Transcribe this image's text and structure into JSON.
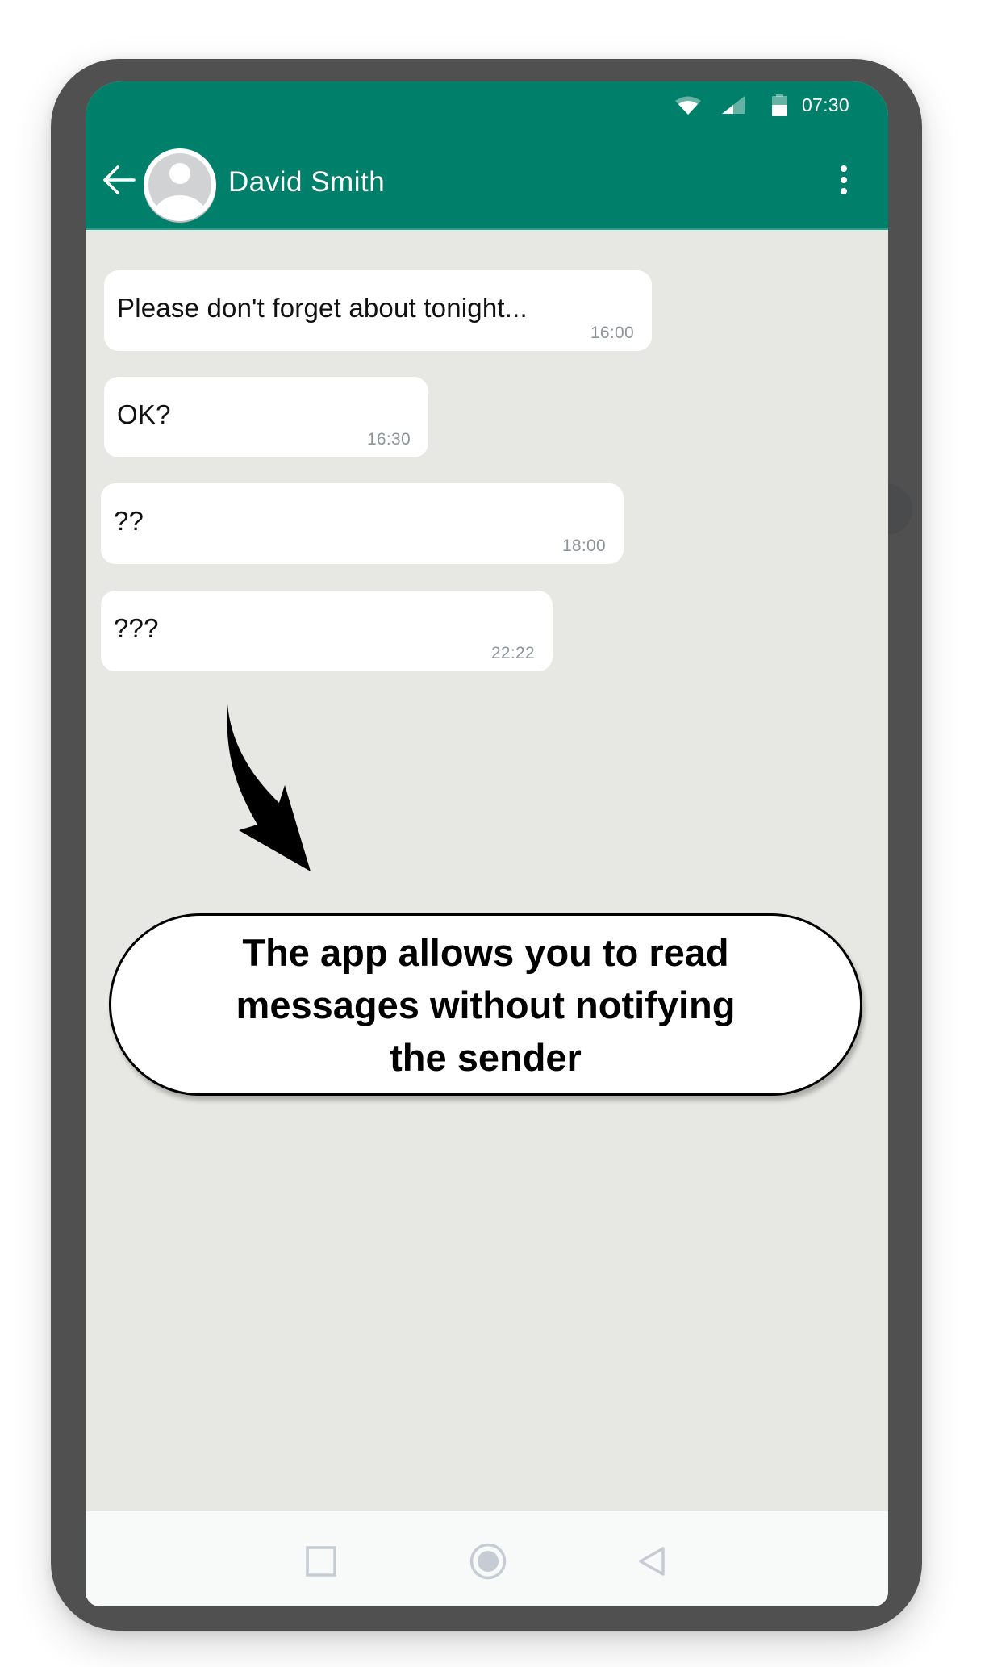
{
  "status_bar": {
    "time": "07:30",
    "icons": [
      "wifi-icon",
      "cellular-signal-icon",
      "battery-icon"
    ]
  },
  "app_bar": {
    "back_icon": "arrow-left-icon",
    "avatar_icon": "default-user-avatar",
    "contact_name": "David Smith",
    "menu_icon": "more-vertical-icon"
  },
  "messages": [
    {
      "text": "Please don't forget about tonight...",
      "time": "16:00"
    },
    {
      "text": "OK?",
      "time": "16:30"
    },
    {
      "text": "??",
      "time": "18:00"
    },
    {
      "text": "???",
      "time": "22:22"
    }
  ],
  "annotation": {
    "arrow_icon": "curved-arrow-down-icon",
    "callout_lines": [
      "The app allows you to read",
      "messages without notifying",
      "the sender"
    ]
  },
  "nav_bar": {
    "recents_icon": "square-recents-icon",
    "home_icon": "circle-home-icon",
    "back_icon": "triangle-back-icon"
  },
  "colors": {
    "header": "#00806a",
    "chat_background": "#e7e7e3",
    "bubble": "#ffffff",
    "timestamp": "#8e9599",
    "frame": "#505050",
    "nav_icons": "#c5ccd3"
  }
}
